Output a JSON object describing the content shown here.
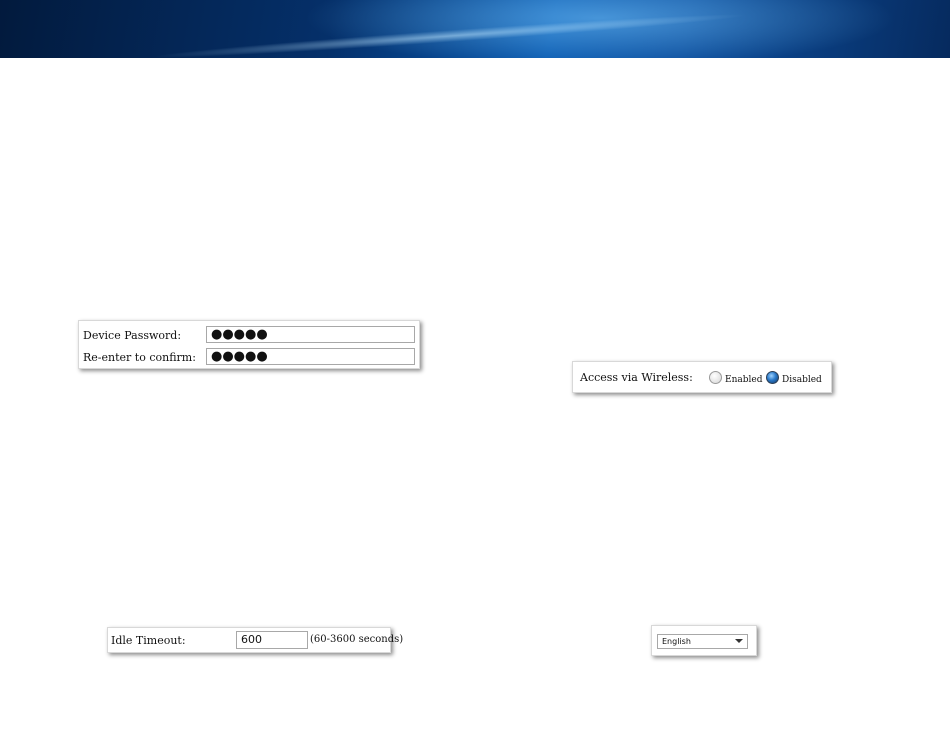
{
  "password_panel": {
    "device_password_label": "Device Password:",
    "device_password_value": "●●●●●",
    "reenter_label": "Re-enter to confirm:",
    "reenter_value": "●●●●●"
  },
  "wireless_panel": {
    "label": "Access via Wireless:",
    "options": [
      "Enabled",
      "Disabled"
    ],
    "selected": "Disabled"
  },
  "timeout_panel": {
    "label": "Idle Timeout:",
    "value": "600",
    "range_hint": "(60-3600 seconds)"
  },
  "language_panel": {
    "selected": "English"
  }
}
